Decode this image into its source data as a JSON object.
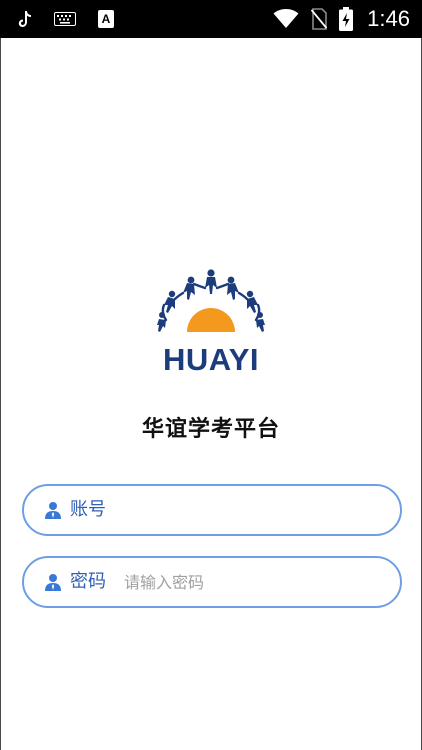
{
  "status_bar": {
    "time": "1:46",
    "left_icons": [
      "tiktok-icon",
      "keyboard-icon",
      "app-a-icon"
    ],
    "app_badge_letter": "A",
    "right_icons": [
      "wifi-icon",
      "no-sim-icon",
      "battery-charging-icon"
    ]
  },
  "logo": {
    "text": "HUAYI",
    "colors": {
      "figures": "#1d3c7c",
      "sun": "#f39a1e",
      "text": "#1d3c7c"
    }
  },
  "app": {
    "title": "华谊学考平台"
  },
  "form": {
    "account": {
      "label": "账号",
      "value": "",
      "placeholder": ""
    },
    "password": {
      "label": "密码",
      "value": "",
      "placeholder": "请输入密码"
    }
  },
  "colors": {
    "accent": "#6e9fe6",
    "label": "#2f5fb8",
    "status_bar_bg": "#000000"
  }
}
